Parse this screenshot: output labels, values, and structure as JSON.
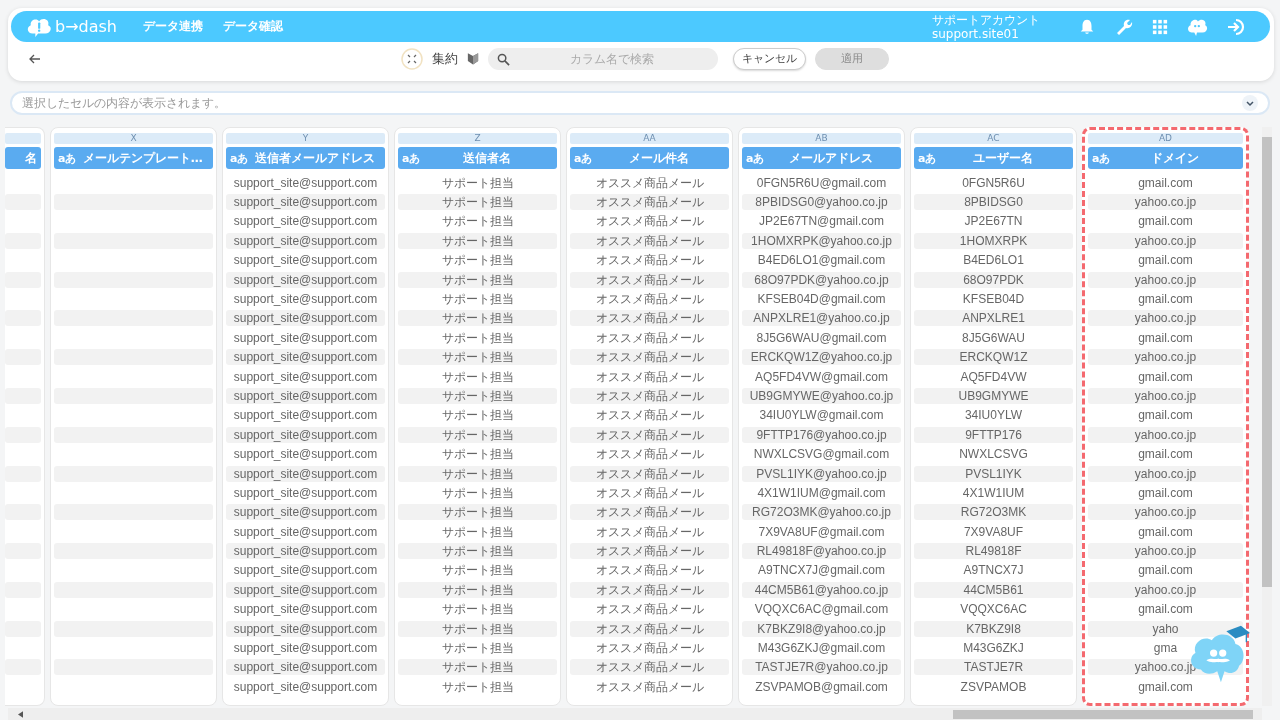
{
  "header": {
    "logo": "b→dash",
    "nav": [
      "データ連携",
      "データ確認"
    ],
    "account": {
      "label": "サポートアカウント",
      "id": "support.site01"
    }
  },
  "toolbar": {
    "aggregate_label": "集約",
    "search": {
      "placeholder": "カラム名で検索"
    },
    "buttons": [
      {
        "label": "キャンセル",
        "disabled": false
      },
      {
        "label": "適用",
        "disabled": true
      }
    ]
  },
  "cell_viewer": {
    "placeholder": "選択したセルの内容が表示されます。"
  },
  "table": {
    "partial_column": {
      "header": "名"
    },
    "columns": [
      {
        "letter": "X",
        "type": "aあ",
        "header": "メールテンプレート…",
        "selected": false
      },
      {
        "letter": "Y",
        "type": "aあ",
        "header": "送信者メールアドレス",
        "selected": false,
        "values": [
          "support_site@support.com",
          "support_site@support.com",
          "support_site@support.com",
          "support_site@support.com",
          "support_site@support.com",
          "support_site@support.com",
          "support_site@support.com",
          "support_site@support.com",
          "support_site@support.com",
          "support_site@support.com",
          "support_site@support.com",
          "support_site@support.com",
          "support_site@support.com",
          "support_site@support.com",
          "support_site@support.com",
          "support_site@support.com",
          "support_site@support.com",
          "support_site@support.com",
          "support_site@support.com",
          "support_site@support.com",
          "support_site@support.com",
          "support_site@support.com",
          "support_site@support.com",
          "support_site@support.com",
          "support_site@support.com",
          "support_site@support.com",
          "support_site@support.com"
        ]
      },
      {
        "letter": "Z",
        "type": "aあ",
        "header": "送信者名",
        "selected": false,
        "values": [
          "サポート担当",
          "サポート担当",
          "サポート担当",
          "サポート担当",
          "サポート担当",
          "サポート担当",
          "サポート担当",
          "サポート担当",
          "サポート担当",
          "サポート担当",
          "サポート担当",
          "サポート担当",
          "サポート担当",
          "サポート担当",
          "サポート担当",
          "サポート担当",
          "サポート担当",
          "サポート担当",
          "サポート担当",
          "サポート担当",
          "サポート担当",
          "サポート担当",
          "サポート担当",
          "サポート担当",
          "サポート担当",
          "サポート担当",
          "サポート担当"
        ]
      },
      {
        "letter": "AA",
        "type": "aあ",
        "header": "メール件名",
        "selected": false,
        "values": [
          "オススメ商品メール",
          "オススメ商品メール",
          "オススメ商品メール",
          "オススメ商品メール",
          "オススメ商品メール",
          "オススメ商品メール",
          "オススメ商品メール",
          "オススメ商品メール",
          "オススメ商品メール",
          "オススメ商品メール",
          "オススメ商品メール",
          "オススメ商品メール",
          "オススメ商品メール",
          "オススメ商品メール",
          "オススメ商品メール",
          "オススメ商品メール",
          "オススメ商品メール",
          "オススメ商品メール",
          "オススメ商品メール",
          "オススメ商品メール",
          "オススメ商品メール",
          "オススメ商品メール",
          "オススメ商品メール",
          "オススメ商品メール",
          "オススメ商品メール",
          "オススメ商品メール",
          "オススメ商品メール"
        ]
      },
      {
        "letter": "AB",
        "type": "aあ",
        "header": "メールアドレス",
        "selected": false,
        "values": [
          "0FGN5R6U@gmail.com",
          "8PBIDSG0@yahoo.co.jp",
          "JP2E67TN@gmail.com",
          "1HOMXRPK@yahoo.co.jp",
          "B4ED6LO1@gmail.com",
          "68O97PDK@yahoo.co.jp",
          "KFSEB04D@gmail.com",
          "ANPXLRE1@yahoo.co.jp",
          "8J5G6WAU@gmail.com",
          "ERCKQW1Z@yahoo.co.jp",
          "AQ5FD4VW@gmail.com",
          "UB9GMYWE@yahoo.co.jp",
          "34IU0YLW@gmail.com",
          "9FTTP176@yahoo.co.jp",
          "NWXLCSVG@gmail.com",
          "PVSL1IYK@yahoo.co.jp",
          "4X1W1IUM@gmail.com",
          "RG72O3MK@yahoo.co.jp",
          "7X9VA8UF@gmail.com",
          "RL49818F@yahoo.co.jp",
          "A9TNCX7J@gmail.com",
          "44CM5B61@yahoo.co.jp",
          "VQQXC6AC@gmail.com",
          "K7BKZ9I8@yahoo.co.jp",
          "M43G6ZKJ@gmail.com",
          "TASTJE7R@yahoo.co.jp",
          "ZSVPAMOB@gmail.com"
        ]
      },
      {
        "letter": "AC",
        "type": "aあ",
        "header": "ユーザー名",
        "selected": false,
        "values": [
          "0FGN5R6U",
          "8PBIDSG0",
          "JP2E67TN",
          "1HOMXRPK",
          "B4ED6LO1",
          "68O97PDK",
          "KFSEB04D",
          "ANPXLRE1",
          "8J5G6WAU",
          "ERCKQW1Z",
          "AQ5FD4VW",
          "UB9GMYWE",
          "34IU0YLW",
          "9FTTP176",
          "NWXLCSVG",
          "PVSL1IYK",
          "4X1W1IUM",
          "RG72O3MK",
          "7X9VA8UF",
          "RL49818F",
          "A9TNCX7J",
          "44CM5B61",
          "VQQXC6AC",
          "K7BKZ9I8",
          "M43G6ZKJ",
          "TASTJE7R",
          "ZSVPAMOB"
        ]
      },
      {
        "letter": "AD",
        "type": "aあ",
        "header": "ドメイン",
        "selected": true,
        "values": [
          "gmail.com",
          "yahoo.co.jp",
          "gmail.com",
          "yahoo.co.jp",
          "gmail.com",
          "yahoo.co.jp",
          "gmail.com",
          "yahoo.co.jp",
          "gmail.com",
          "yahoo.co.jp",
          "gmail.com",
          "yahoo.co.jp",
          "gmail.com",
          "yahoo.co.jp",
          "gmail.com",
          "yahoo.co.jp",
          "gmail.com",
          "yahoo.co.jp",
          "gmail.com",
          "yahoo.co.jp",
          "gmail.com",
          "yahoo.co.jp",
          "gmail.com",
          "yaho",
          "gma",
          "yahoo.co.jp",
          "gmail.com"
        ]
      }
    ]
  }
}
